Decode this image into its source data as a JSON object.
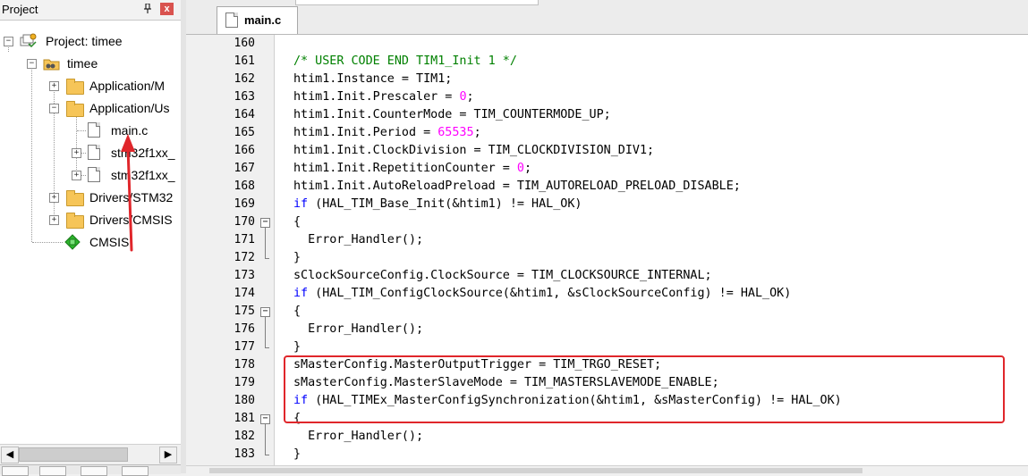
{
  "project_panel": {
    "title": "Project",
    "pin": "ᴘ",
    "close": "x",
    "tree": [
      {
        "label": "Project: timee"
      },
      {
        "label": "timee"
      },
      {
        "label": "Application/M"
      },
      {
        "label": "Application/Us"
      },
      {
        "label": "main.c"
      },
      {
        "label": "stm32f1xx_"
      },
      {
        "label": "stm32f1xx_"
      },
      {
        "label": "Drivers/STM32"
      },
      {
        "label": "Drivers/CMSIS"
      },
      {
        "label": "CMSIS"
      }
    ]
  },
  "editor": {
    "tab_label": "main.c",
    "lines": [
      {
        "n": "160"
      },
      {
        "n": "161"
      },
      {
        "n": "162"
      },
      {
        "n": "163"
      },
      {
        "n": "164"
      },
      {
        "n": "165"
      },
      {
        "n": "166"
      },
      {
        "n": "167"
      },
      {
        "n": "168"
      },
      {
        "n": "169"
      },
      {
        "n": "170"
      },
      {
        "n": "171"
      },
      {
        "n": "172"
      },
      {
        "n": "173"
      },
      {
        "n": "174"
      },
      {
        "n": "175"
      },
      {
        "n": "176"
      },
      {
        "n": "177"
      },
      {
        "n": "178"
      },
      {
        "n": "179"
      },
      {
        "n": "180"
      },
      {
        "n": "181"
      },
      {
        "n": "182"
      },
      {
        "n": "183"
      }
    ],
    "code": {
      "l161": "/* USER CODE END TIM1_Init 1 */",
      "l162": "htim1.Instance = TIM1;",
      "l163a": "htim1.Init.Prescaler = ",
      "l163n": "0",
      "l163b": ";",
      "l164": "htim1.Init.CounterMode = TIM_COUNTERMODE_UP;",
      "l165a": "htim1.Init.Period = ",
      "l165n": "65535",
      "l165b": ";",
      "l166": "htim1.Init.ClockDivision = TIM_CLOCKDIVISION_DIV1;",
      "l167a": "htim1.Init.RepetitionCounter = ",
      "l167n": "0",
      "l167b": ";",
      "l168": "htim1.Init.AutoReloadPreload = TIM_AUTORELOAD_PRELOAD_DISABLE;",
      "l169k": "if",
      "l169": " (HAL_TIM_Base_Init(&htim1) != HAL_OK)",
      "l170": "{",
      "l171": "  Error_Handler();",
      "l172": "}",
      "l173": "sClockSourceConfig.ClockSource = TIM_CLOCKSOURCE_INTERNAL;",
      "l174k": "if",
      "l174": " (HAL_TIM_ConfigClockSource(&htim1, &sClockSourceConfig) != HAL_OK)",
      "l175": "{",
      "l176": "  Error_Handler();",
      "l177": "}",
      "l178": "sMasterConfig.MasterOutputTrigger = TIM_TRGO_RESET;",
      "l179": "sMasterConfig.MasterSlaveMode = TIM_MASTERSLAVEMODE_ENABLE;",
      "l180k": "if",
      "l180": " (HAL_TIMEx_MasterConfigSynchronization(&htim1, &sMasterConfig) != HAL_OK)",
      "l181": "{",
      "l182": "  Error_Handler();",
      "l183": "}"
    }
  },
  "colors": {
    "comment": "#008000",
    "keyword": "#0000ff",
    "number": "#ff00ff",
    "highlight_box": "#e0262b"
  },
  "icons": {
    "pin": "pin-icon",
    "close": "close-icon",
    "project": "project-icon",
    "folder": "folder-icon",
    "file": "file-icon",
    "cmsis": "cmsis-diamond-icon"
  }
}
